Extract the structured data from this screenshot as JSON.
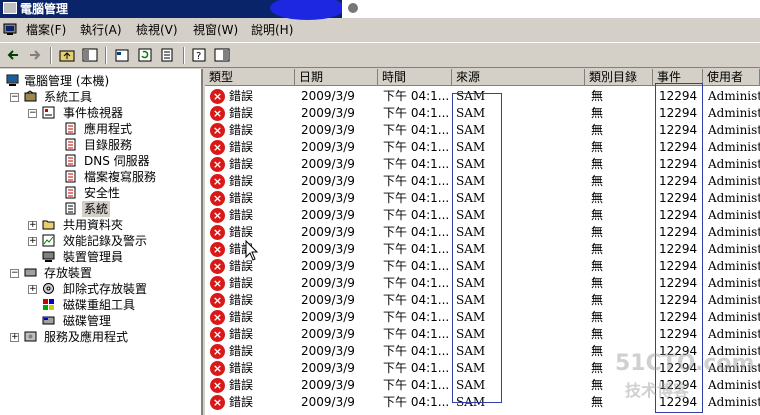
{
  "window": {
    "title": "電腦管理",
    "colors": {
      "title_bg": "#0a246a",
      "error_red": "#d91818",
      "annotation_blue": "#3040a8"
    }
  },
  "menu": [
    "檔案(F)",
    "執行(A)",
    "檢視(V)",
    "視窗(W)",
    "說明(H)"
  ],
  "toolbar": {
    "icons": [
      "back-arrow-icon",
      "forward-arrow-icon",
      "up-folder-icon",
      "show-hide-tree-icon",
      "properties-icon",
      "refresh-icon",
      "export-list-icon",
      "help-icon",
      "show-hide-action-pane-icon"
    ]
  },
  "tree": [
    {
      "label": "電腦管理 (本機)",
      "icon": "computer-icon",
      "expander": ""
    },
    {
      "label": "系統工具",
      "icon": "tools-icon",
      "expander": "−"
    },
    {
      "label": "事件檢視器",
      "icon": "event-viewer-icon",
      "expander": "−"
    },
    {
      "label": "應用程式",
      "icon": "log-icon",
      "expander": ""
    },
    {
      "label": "目錄服務",
      "icon": "log-icon",
      "expander": ""
    },
    {
      "label": "DNS 伺服器",
      "icon": "log-icon",
      "expander": ""
    },
    {
      "label": "檔案複寫服務",
      "icon": "log-icon",
      "expander": ""
    },
    {
      "label": "安全性",
      "icon": "log-icon",
      "expander": ""
    },
    {
      "label": "系統",
      "icon": "log-icon",
      "expander": ""
    },
    {
      "label": "共用資料夾",
      "icon": "folder-icon",
      "expander": "+"
    },
    {
      "label": "效能記錄及警示",
      "icon": "performance-icon",
      "expander": "+"
    },
    {
      "label": "裝置管理員",
      "icon": "device-icon",
      "expander": ""
    },
    {
      "label": "存放裝置",
      "icon": "storage-icon",
      "expander": "−"
    },
    {
      "label": "卸除式存放裝置",
      "icon": "removable-storage-icon",
      "expander": "+"
    },
    {
      "label": "磁碟重組工具",
      "icon": "defrag-icon",
      "expander": ""
    },
    {
      "label": "磁碟管理",
      "icon": "disk-icon",
      "expander": ""
    },
    {
      "label": "服務及應用程式",
      "icon": "services-icon",
      "expander": "+"
    }
  ],
  "columns": [
    "類型",
    "日期",
    "時間",
    "來源",
    "類別目錄",
    "事件",
    "使用者"
  ],
  "rows": [
    {
      "type": "錯誤",
      "date": "2009/3/9",
      "time": "下午 04:1...",
      "source": "SAM",
      "category": "無",
      "event": "12294",
      "user": "Administra"
    },
    {
      "type": "錯誤",
      "date": "2009/3/9",
      "time": "下午 04:1...",
      "source": "SAM",
      "category": "無",
      "event": "12294",
      "user": "Administra"
    },
    {
      "type": "錯誤",
      "date": "2009/3/9",
      "time": "下午 04:1...",
      "source": "SAM",
      "category": "無",
      "event": "12294",
      "user": "Administra"
    },
    {
      "type": "錯誤",
      "date": "2009/3/9",
      "time": "下午 04:1...",
      "source": "SAM",
      "category": "無",
      "event": "12294",
      "user": "Administra"
    },
    {
      "type": "錯誤",
      "date": "2009/3/9",
      "time": "下午 04:1...",
      "source": "SAM",
      "category": "無",
      "event": "12294",
      "user": "Administra"
    },
    {
      "type": "錯誤",
      "date": "2009/3/9",
      "time": "下午 04:1...",
      "source": "SAM",
      "category": "無",
      "event": "12294",
      "user": "Administra"
    },
    {
      "type": "錯誤",
      "date": "2009/3/9",
      "time": "下午 04:1...",
      "source": "SAM",
      "category": "無",
      "event": "12294",
      "user": "Administra"
    },
    {
      "type": "錯誤",
      "date": "2009/3/9",
      "time": "下午 04:1...",
      "source": "SAM",
      "category": "無",
      "event": "12294",
      "user": "Administra"
    },
    {
      "type": "錯誤",
      "date": "2009/3/9",
      "time": "下午 04:1...",
      "source": "SAM",
      "category": "無",
      "event": "12294",
      "user": "Administra"
    },
    {
      "type": "錯誤",
      "date": "2009/3/9",
      "time": "下午 04:1...",
      "source": "SAM",
      "category": "無",
      "event": "12294",
      "user": "Administra"
    },
    {
      "type": "錯誤",
      "date": "2009/3/9",
      "time": "下午 04:1...",
      "source": "SAM",
      "category": "無",
      "event": "12294",
      "user": "Administra"
    },
    {
      "type": "錯誤",
      "date": "2009/3/9",
      "time": "下午 04:1...",
      "source": "SAM",
      "category": "無",
      "event": "12294",
      "user": "Administra"
    },
    {
      "type": "錯誤",
      "date": "2009/3/9",
      "time": "下午 04:1...",
      "source": "SAM",
      "category": "無",
      "event": "12294",
      "user": "Administra"
    },
    {
      "type": "錯誤",
      "date": "2009/3/9",
      "time": "下午 04:1...",
      "source": "SAM",
      "category": "無",
      "event": "12294",
      "user": "Administra"
    },
    {
      "type": "錯誤",
      "date": "2009/3/9",
      "time": "下午 04:1...",
      "source": "SAM",
      "category": "無",
      "event": "12294",
      "user": "Administra"
    },
    {
      "type": "錯誤",
      "date": "2009/3/9",
      "time": "下午 04:1...",
      "source": "SAM",
      "category": "無",
      "event": "12294",
      "user": "Administra"
    },
    {
      "type": "錯誤",
      "date": "2009/3/9",
      "time": "下午 04:1...",
      "source": "SAM",
      "category": "無",
      "event": "12294",
      "user": "Administra"
    },
    {
      "type": "錯誤",
      "date": "2009/3/9",
      "time": "下午 04:1...",
      "source": "SAM",
      "category": "無",
      "event": "12294",
      "user": "Administra"
    },
    {
      "type": "錯誤",
      "date": "2009/3/9",
      "time": "下午 04:1...",
      "source": "SAM",
      "category": "無",
      "event": "12294",
      "user": "Administra"
    }
  ],
  "watermark": {
    "line1": "51CTO.com",
    "line2": "技术博客"
  }
}
